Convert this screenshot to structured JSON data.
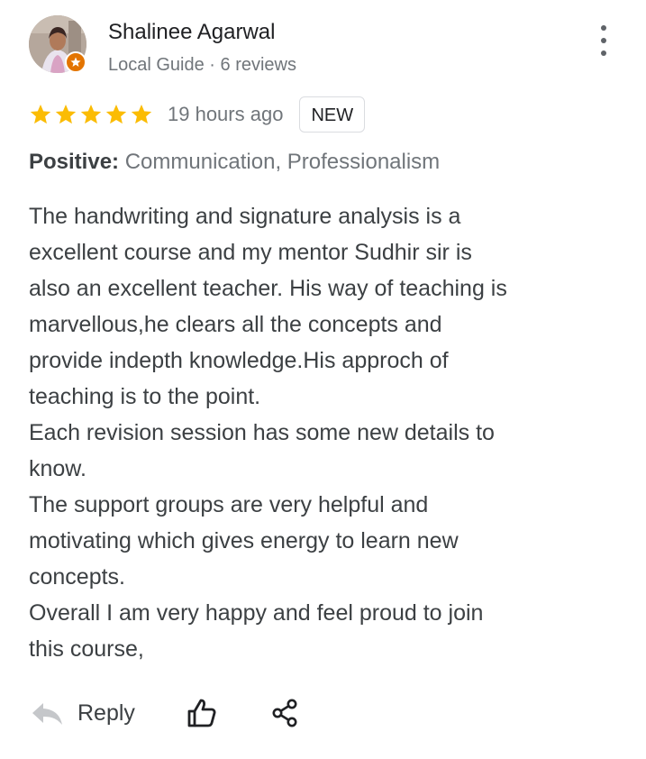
{
  "review": {
    "author_name": "Shalinee Agarwal",
    "author_meta": "Local Guide · 6 reviews",
    "rating": 5,
    "time_ago": "19 hours ago",
    "badge": "NEW",
    "highlight_label": "Positive:",
    "highlight_value": "Communication, Professionalism",
    "body_lines": [
      "The handwriting and signature analysis is a",
      "excellent course and my mentor Sudhir sir is",
      "also an excellent teacher. His way of teaching is",
      "marvellous,he clears all the concepts and",
      "provide indepth knowledge.His approch of",
      "teaching is to the point.",
      "Each revision session has some new details to",
      "know.",
      "The support groups are very helpful and",
      "motivating which gives energy to learn new",
      "concepts.",
      "Overall I am very happy and feel proud to join",
      "this course,"
    ]
  },
  "actions": {
    "reply_label": "Reply",
    "reply_icon": "reply-arrow-icon",
    "like_icon": "thumbs-up-icon",
    "share_icon": "share-icon"
  },
  "icons": {
    "more": "more-vert-icon",
    "local_guide": "local-guide-badge-icon",
    "star": "star-icon"
  },
  "colors": {
    "star": "#fbbc04",
    "local_guide_badge": "#e37400",
    "secondary_text": "#70757a",
    "primary_text": "#3c4043"
  }
}
